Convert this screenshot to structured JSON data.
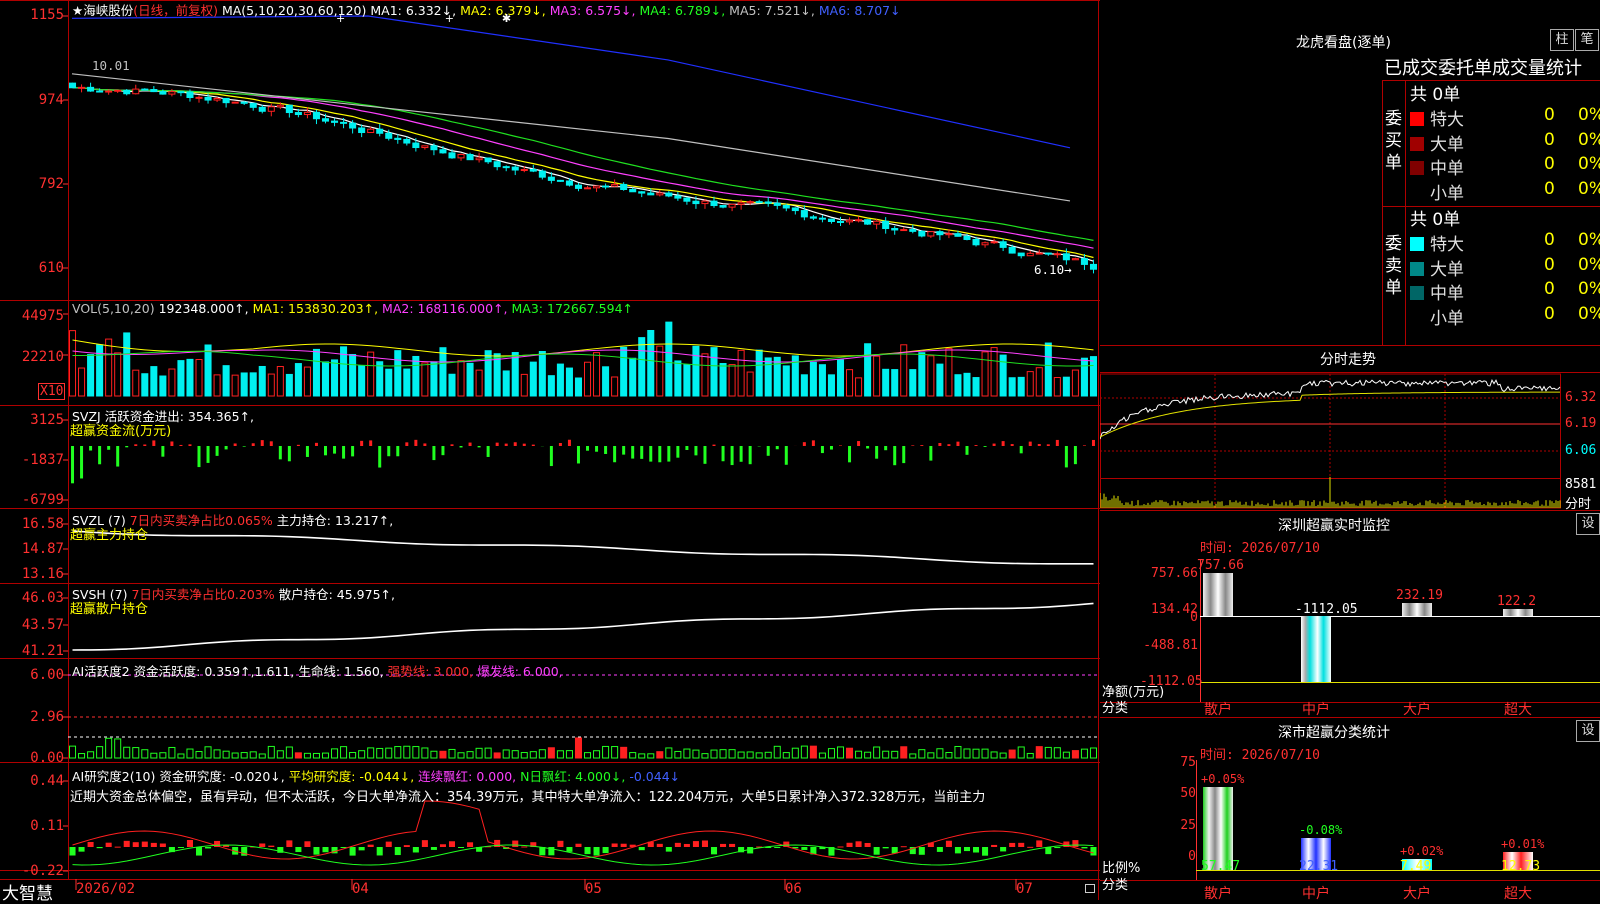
{
  "colors": {
    "up": "#ff2020",
    "down": "#00f0f0",
    "grid": "#b00000",
    "ma1": "#ffffff",
    "ma2": "#ffff00",
    "ma3": "#ff40ff",
    "ma4": "#20e020",
    "ma5": "#c0c0c0",
    "ma6": "#2030ff"
  },
  "chart": {
    "title": "★海峡股份",
    "mode": "(日线，前复权)",
    "ma_label": "MA(5,10,20,30,60,120)",
    "ma1": "MA1: 6.332↓,",
    "ma2": "MA2: 6.379↓,",
    "ma3": "MA3: 6.575↓,",
    "ma4": "MA4: 6.789↓,",
    "ma5": "MA5: 7.521↓,",
    "ma6": "MA6: 8.707↓",
    "y_ticks": [
      "1155",
      "974",
      "792",
      "610"
    ],
    "high_note": "10.01",
    "low_note": "6.10→",
    "marker_top": "+ +✱"
  },
  "vol": {
    "label": "VOL(5,10,20)",
    "value": "192348.000↑,",
    "ma1": "MA1: 153830.203↑,",
    "ma2": "MA2: 168116.000↑,",
    "ma3": "MA3: 172667.594↑",
    "y_ticks": [
      "44975",
      "22210"
    ],
    "unit": "X10"
  },
  "svzj": {
    "label": "SVZJ  活跃资金进出: 354.365↑,",
    "sub": "超赢资金流(万元)",
    "y_ticks": [
      "3125",
      "-1837",
      "-6799"
    ]
  },
  "svzl": {
    "label": "SVZL (7)",
    "ratio": "7日内买卖净占比0.065%",
    "hold": "主力持仓: 13.217↑,",
    "sub": "超赢主力持仓",
    "y_ticks": [
      "16.58",
      "14.87",
      "13.16"
    ]
  },
  "svsh": {
    "label": "SVSH (7)",
    "ratio": "7日内买卖净占比0.203%",
    "hold": "散户持仓: 45.975↑,",
    "sub": "超赢散户持仓",
    "y_ticks": [
      "46.03",
      "43.57",
      "41.21"
    ]
  },
  "ai1": {
    "label": "AI活跃度2 资金活跃度: 0.359↑,1.611,",
    "life": "生命线: 1.560,",
    "strong": "强势线: 3.000,",
    "burst": "爆发线: 6.000,",
    "y_ticks": [
      "6.00",
      "2.96",
      "0.00"
    ]
  },
  "ai2": {
    "label": "AI研究度2(10) 资金研究度: -0.020↓,",
    "avg": "平均研究度: -0.044↓,",
    "red1": "连续飘红: 0.000,",
    "red2": "N日飘红: 4.000↓,",
    "neg": "-0.044↓",
    "desc": "近期大资金总体偏空，虽有异动，但不太活跃，今日大单净流入：354.39万元，其中特大单净流入：122.204万元，大单5日累计净入372.328万元，当前主力",
    "y_ticks": [
      "0.44",
      "0.11",
      "-0.22"
    ]
  },
  "xaxis": {
    "brand": "大智慧",
    "labels": [
      "2026/02",
      "04",
      "05",
      "06",
      "07"
    ]
  },
  "right": {
    "lhb_title": "龙虎看盘(逐单)",
    "btn_zhu": "柱",
    "btn_bi": "笔",
    "stat_title": "已成交委托单成交量统计",
    "buy_label": "委买单",
    "sell_label": "委卖单",
    "buy_total": "共 0单",
    "sell_total": "共 0单",
    "buy_rows": [
      {
        "name": "特大",
        "count": "0",
        "pct": "0%"
      },
      {
        "name": "大单",
        "count": "0",
        "pct": "0%"
      },
      {
        "name": "中单",
        "count": "0",
        "pct": "0%"
      },
      {
        "name": "小单",
        "count": "0",
        "pct": "0%"
      }
    ],
    "sell_rows": [
      {
        "name": "特大",
        "count": "0",
        "pct": "0%"
      },
      {
        "name": "大单",
        "count": "0",
        "pct": "0%"
      },
      {
        "name": "中单",
        "count": "0",
        "pct": "0%"
      },
      {
        "name": "小单",
        "count": "0",
        "pct": "0%"
      }
    ],
    "buy_colors": [
      "#ff0000",
      "#a00000",
      "#800000",
      "#000000"
    ],
    "sell_colors": [
      "#00ffff",
      "#008888",
      "#006666",
      "#000000"
    ],
    "intraday_title": "分时走势",
    "intraday_ticks": [
      "6.32",
      "6.19",
      "6.06"
    ],
    "intraday_vol": "8581",
    "intraday_vol_unit": "分时",
    "monitor_title": "深圳超赢实时监控",
    "monitor_set": "设",
    "monitor_time": "时间: 2026/07/10",
    "monitor_ticks": [
      "757.66",
      "134.42",
      "0",
      "-488.81",
      "-1112.05"
    ],
    "monitor_ylabel1": "净额(万元)",
    "monitor_ylabel2": "分类",
    "monitor_bars": [
      {
        "cat": "散户",
        "value": 757.66,
        "label": "757.66"
      },
      {
        "cat": "中户",
        "value": -1112.05,
        "label": "-1112.05"
      },
      {
        "cat": "大户",
        "value": 232.19,
        "label": "232.19"
      },
      {
        "cat": "超大",
        "value": 122.2,
        "label": "122.2"
      }
    ],
    "class_title": "深市超赢分类统计",
    "class_set": "设",
    "class_time": "时间: 2026/07/10",
    "class_ticks": [
      "75",
      "50",
      "25",
      "0"
    ],
    "class_ylabel1": "比例%",
    "class_ylabel2": "分类",
    "class_bars": [
      {
        "cat": "散户",
        "value": 57.47,
        "label": "57.47",
        "delta": "+0.05%"
      },
      {
        "cat": "中户",
        "value": 22.31,
        "label": "22.31",
        "delta": "-0.08%"
      },
      {
        "cat": "大户",
        "value": 7.49,
        "label": "7.49",
        "delta": "+0.02%"
      },
      {
        "cat": "超大",
        "value": 12.73,
        "label": "12.73",
        "delta": "+0.01%"
      }
    ]
  }
}
